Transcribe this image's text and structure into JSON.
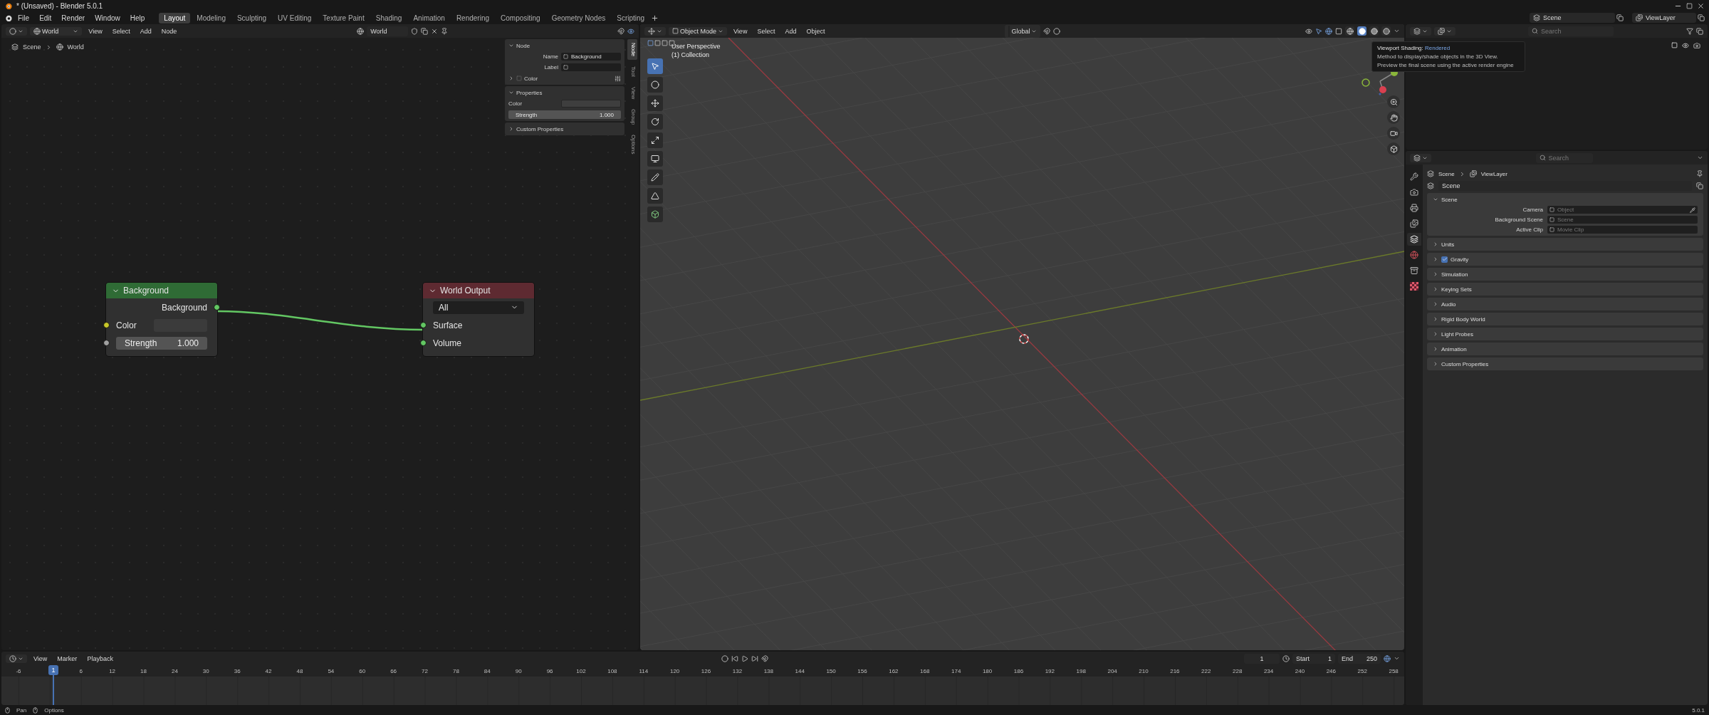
{
  "window": {
    "title": "* (Unsaved) - Blender 5.0.1"
  },
  "menu": [
    "File",
    "Edit",
    "Render",
    "Window",
    "Help"
  ],
  "workspaces": [
    {
      "label": "Layout",
      "selected": true
    },
    {
      "label": "Modeling",
      "selected": false
    },
    {
      "label": "Sculpting",
      "selected": false
    },
    {
      "label": "UV Editing",
      "selected": false
    },
    {
      "label": "Texture Paint",
      "selected": false
    },
    {
      "label": "Shading",
      "selected": false
    },
    {
      "label": "Animation",
      "selected": false
    },
    {
      "label": "Rendering",
      "selected": false
    },
    {
      "label": "Compositing",
      "selected": false
    },
    {
      "label": "Geometry Nodes",
      "selected": false
    },
    {
      "label": "Scripting",
      "selected": false
    }
  ],
  "scene_field": "Scene",
  "view_layer_field": "ViewLayer",
  "node_editor": {
    "type_field": "World",
    "menus": [
      "View",
      "Select",
      "Add",
      "Node"
    ],
    "world_field": "World",
    "breadcrumb": [
      "Scene",
      "World"
    ],
    "sidebar_tabs": [
      {
        "label": "Node",
        "selected": true
      },
      {
        "label": "Tool",
        "selected": false
      },
      {
        "label": "View",
        "selected": false
      },
      {
        "label": "Group",
        "selected": false
      },
      {
        "label": "Options",
        "selected": false
      }
    ],
    "node_panel": {
      "title": "Node",
      "name_label": "Name",
      "name_value": "Background",
      "label_label": "Label",
      "color_label": "Color"
    },
    "properties_panel": {
      "title": "Properties",
      "color_label": "Color",
      "strength_label": "Strength",
      "strength_value": "1.000"
    },
    "custom_properties": "Custom Properties",
    "nodes": [
      {
        "kind": "background",
        "title": "Background",
        "output": "Background",
        "color_label": "Color",
        "strength_label": "Strength",
        "strength_value": "1.000"
      },
      {
        "kind": "output",
        "title": "World Output",
        "target": "All",
        "inputs": [
          "Surface",
          "Volume"
        ]
      }
    ]
  },
  "viewport": {
    "mode_field": "Object Mode",
    "menus": [
      "View",
      "Select",
      "Add",
      "Object"
    ],
    "orientation_field": "Global",
    "overlay_lines": [
      "User Perspective",
      "(1) Collection"
    ],
    "shading_modes": [
      {
        "kind": "wireframe",
        "selected": false
      },
      {
        "kind": "solid",
        "selected": true
      },
      {
        "kind": "material",
        "selected": false
      },
      {
        "kind": "rendered",
        "selected": false
      }
    ],
    "tooltip": {
      "title": "Viewport Shading:",
      "value": "Rendered",
      "lines": [
        "Method to display/shade objects in the 3D View.",
        "Preview the final scene using the active render engine"
      ]
    }
  },
  "outliner": {
    "search_placeholder": "Search"
  },
  "properties": {
    "search_placeholder": "Search",
    "breadcrumb": [
      "Scene",
      "ViewLayer"
    ],
    "scene_field": "Scene",
    "tabs": [
      {
        "kind": "tool",
        "selected": false
      },
      {
        "kind": "render",
        "selected": false
      },
      {
        "kind": "output",
        "selected": false
      },
      {
        "kind": "view-layer",
        "selected": false
      },
      {
        "kind": "scene",
        "selected": true
      },
      {
        "kind": "world",
        "selected": false
      },
      {
        "kind": "collection",
        "selected": false
      },
      {
        "kind": "texture",
        "selected": false
      }
    ],
    "scene_panel": {
      "title": "Scene",
      "fields": [
        {
          "label": "Camera",
          "placeholder": "Object"
        },
        {
          "label": "Background Scene",
          "placeholder": "Scene"
        },
        {
          "label": "Active Clip",
          "placeholder": "Movie Clip"
        }
      ]
    },
    "panels": [
      {
        "title": "Units"
      },
      {
        "title": "Gravity",
        "checked": true
      },
      {
        "title": "Simulation"
      },
      {
        "title": "Keying Sets"
      },
      {
        "title": "Audio"
      },
      {
        "title": "Rigid Body World"
      },
      {
        "title": "Light Probes"
      },
      {
        "title": "Animation"
      },
      {
        "title": "Custom Properties"
      }
    ]
  },
  "timeline": {
    "menus": [
      "View",
      "Marker",
      "Playback"
    ],
    "current_frame": "1",
    "start_label": "Start",
    "start_value": "1",
    "end_label": "End",
    "end_value": "250",
    "playhead": "1",
    "ticks": [
      "-6",
      "6",
      "12",
      "18",
      "24",
      "30",
      "36",
      "42",
      "48",
      "54",
      "60",
      "66",
      "72",
      "78",
      "84",
      "90",
      "96",
      "102",
      "108",
      "114",
      "120",
      "126",
      "132",
      "138",
      "144",
      "150",
      "156",
      "162",
      "168",
      "174",
      "180",
      "186",
      "192",
      "198",
      "204",
      "210",
      "216",
      "222",
      "228",
      "234",
      "240",
      "246",
      "252",
      "258"
    ]
  },
  "status_bar": {
    "hints": [
      "Pan",
      "Options"
    ],
    "version": "5.0.1"
  }
}
